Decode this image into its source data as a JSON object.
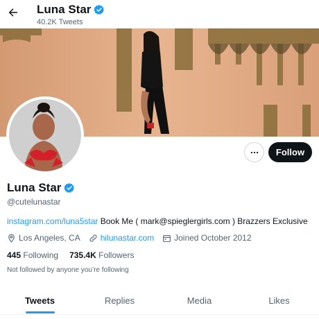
{
  "header": {
    "name": "Luna Star",
    "tweet_count": "40.2K Tweets",
    "back_icon": "arrow-left-icon",
    "verified_icon": "verified-badge-icon"
  },
  "profile": {
    "name": "Luna Star",
    "handle": "@cutelunastar",
    "follow_label": "Follow",
    "more_icon": "more-horizontal-icon",
    "bio": {
      "link": "instagram.com/luna5star",
      "text": " Book Me ( mark@spieglergirls.com ) Brazzers Exclusive"
    },
    "location": "Los Angeles, CA",
    "website": "hilunastar.com",
    "joined": "Joined October 2012",
    "following_count": "445",
    "following_label": "Following",
    "followers_count": "735.4K",
    "followers_label": "Followers",
    "followed_by": "Not followed by anyone you’re following"
  },
  "tabs": [
    {
      "label": "Tweets",
      "active": true
    },
    {
      "label": "Replies",
      "active": false
    },
    {
      "label": "Media",
      "active": false
    },
    {
      "label": "Likes",
      "active": false
    }
  ],
  "colors": {
    "accent": "#1d9bf0",
    "text": "#0f1419",
    "secondary": "#536471",
    "follow_bg": "#0f1419"
  }
}
